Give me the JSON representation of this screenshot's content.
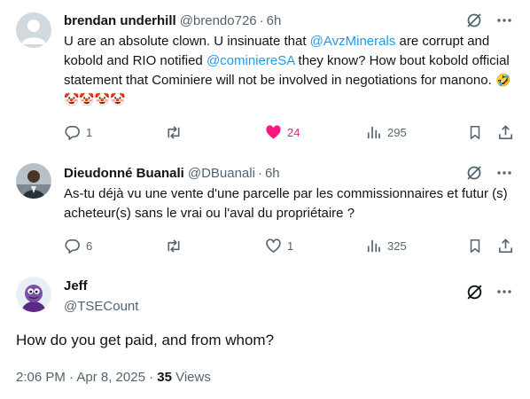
{
  "replies": [
    {
      "name": "brendan underhill",
      "handle": "@brendo726",
      "sep": "·",
      "time": "6h",
      "text_parts": [
        {
          "t": "U are an absolute clown. U insinuate that ",
          "link": false
        },
        {
          "t": "@AvzMinerals",
          "link": true
        },
        {
          "t": " are corrupt and kobold and RIO notified ",
          "link": false
        },
        {
          "t": "@cominiereSA",
          "link": true
        },
        {
          "t": " they know? How bout kobold official statement that Cominiere will not be involved in negotiations for manono. ",
          "link": false
        }
      ],
      "emojis": "🤣🤡🤡🤡🤡",
      "stats": {
        "replies": "1",
        "reposts": "",
        "likes": "24",
        "views": "295"
      },
      "liked": true
    },
    {
      "name": "Dieudonné Buanali",
      "handle": "@DBuanali",
      "sep": "·",
      "time": "6h",
      "text": "As-tu déjà vu une vente d'une parcelle par les commissionnaires et futur (s) acheteur(s) sans le vrai ou l'aval du propriétaire ?",
      "stats": {
        "replies": "6",
        "reposts": "",
        "likes": "1",
        "views": "325"
      },
      "liked": false
    }
  ],
  "main": {
    "name": "Jeff",
    "handle": "@TSECount",
    "text": "How do you get paid, and from whom?",
    "time": "2:06 PM · Apr 8, 2025 · ",
    "views_count": "35",
    "views_label": " Views"
  },
  "colors": {
    "accent": "#1d9bf0",
    "like": "#f91880",
    "muted": "#536471",
    "text": "#0f1419"
  },
  "icons": [
    "grok-icon",
    "more-icon",
    "reply-icon",
    "repost-icon",
    "like-icon",
    "views-icon",
    "bookmark-icon",
    "share-icon"
  ]
}
